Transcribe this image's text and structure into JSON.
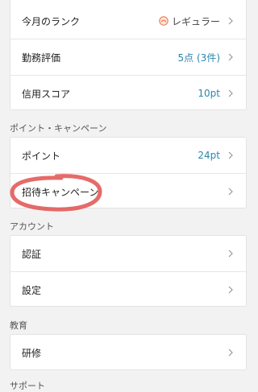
{
  "top_card": {
    "rank": {
      "label": "今月のランク",
      "value": "レギュラー",
      "icon": "rank-badge-icon"
    },
    "evaluation": {
      "label": "勤務評価",
      "value": "5点 (3件)"
    },
    "credit": {
      "label": "信用スコア",
      "value": "10pt"
    }
  },
  "points_section": {
    "title": "ポイント・キャンペーン",
    "points": {
      "label": "ポイント",
      "value": "24pt"
    },
    "invite": {
      "label": "招待キャンペーン"
    }
  },
  "account_section": {
    "title": "アカウント",
    "auth": {
      "label": "認証"
    },
    "settings": {
      "label": "設定"
    }
  },
  "education_section": {
    "title": "教育",
    "training": {
      "label": "研修"
    }
  },
  "support_section": {
    "title": "サポート"
  },
  "colors": {
    "value_blue": "#2c86ad",
    "rank_orange": "#e8734a",
    "annotation_red": "#e0514f",
    "background": "#f2f2f2",
    "card": "#ffffff"
  }
}
